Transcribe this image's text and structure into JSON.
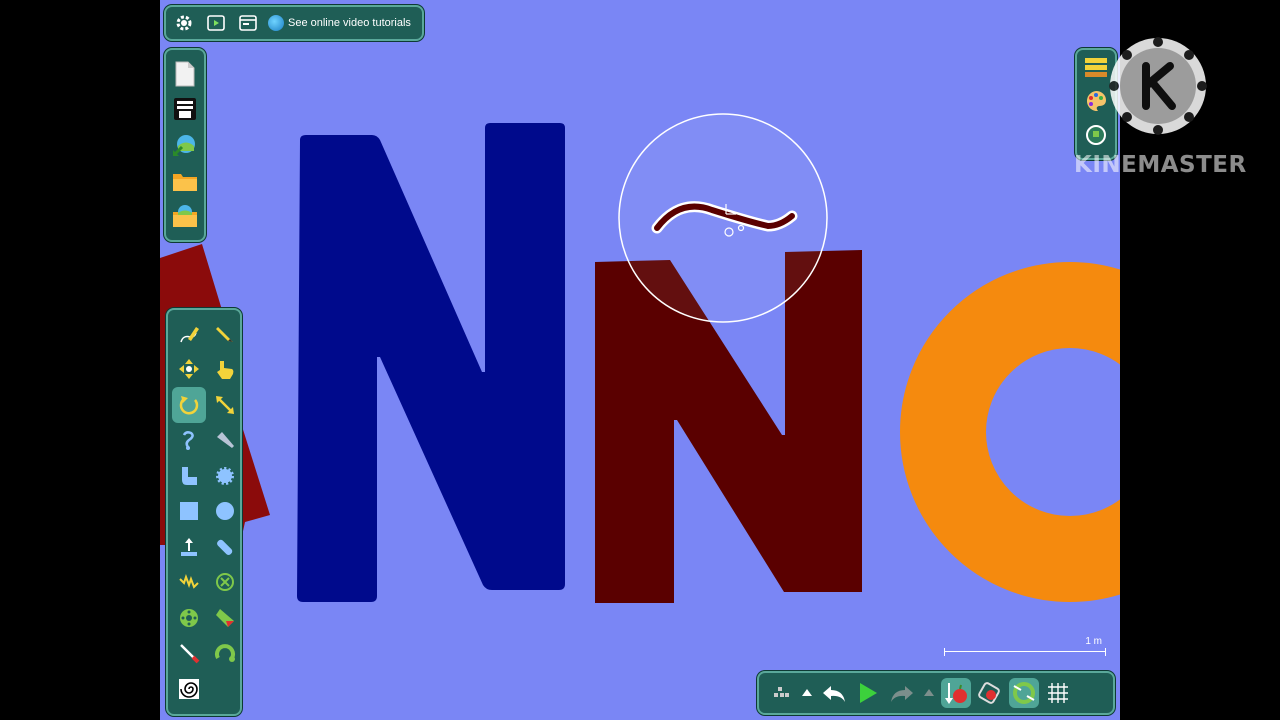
{
  "app": {
    "top_bar": {
      "tutorial_link_label": "See online video tutorials",
      "icons": [
        "settings-icon",
        "play-icon",
        "window-icon",
        "globe-icon"
      ]
    },
    "file_bar": {
      "icons": [
        "new-document-icon",
        "scene-icon",
        "import-icon",
        "open-folder-icon",
        "save-icon"
      ]
    },
    "tool_box": {
      "tools": [
        "draw-icon",
        "pencil-icon",
        "move-icon",
        "drag-icon",
        "rotate-icon",
        "scale-icon",
        "rope-icon",
        "knife-icon",
        "plane-icon",
        "gear-icon",
        "box-icon",
        "circle-icon",
        "thruster-icon",
        "bandage-icon",
        "spring-icon",
        "fixate-icon",
        "hinge-icon",
        "tracer-icon",
        "laser-icon",
        "axle-icon",
        "texture-icon"
      ],
      "active_tool": "rotate-icon"
    },
    "right_bar": {
      "icons": [
        "layers-icon",
        "palette-icon",
        "info-icon"
      ]
    },
    "bottom_bar": {
      "icons": [
        "grid-menu-icon",
        "arrow-up-icon",
        "undo-icon",
        "play-icon",
        "redo-icon",
        "arrow-up-icon",
        "gravity-icon",
        "attraction-icon",
        "collision-icon",
        "grid-icon"
      ]
    },
    "scale_label": "1 m",
    "watermark_text": "KINEMASTER",
    "colors": {
      "canvas": "#7a86f5",
      "blue_letter": "#000a8c",
      "maroon_letter": "#5a0000",
      "ring": "#f58a0e",
      "toolbar": "#1f5e56"
    }
  }
}
